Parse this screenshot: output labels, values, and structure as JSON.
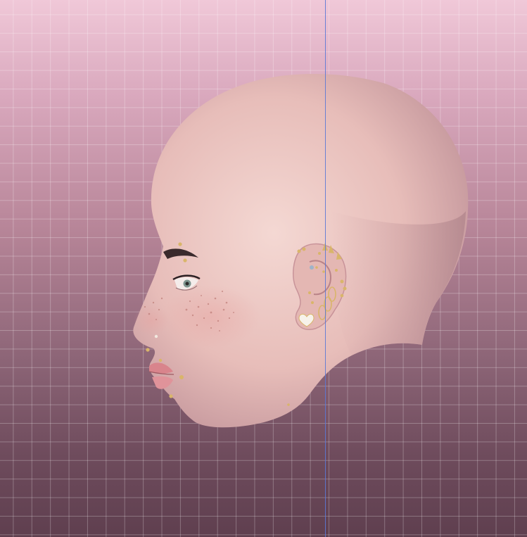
{
  "scene": {
    "subject": "head-model-profile",
    "colors": {
      "background_top": "#f0c8d8",
      "background_bottom": "#5f3f4f",
      "grid_line": "#ffffff",
      "center_axis": "#5b79d6",
      "skin_light": "#f2d4d0",
      "skin_shadow": "#b98f94",
      "jewelry_gold": "#d9b56a",
      "freckle": "#b8746e",
      "lips": "#d9848c"
    },
    "icons": [
      "head-model",
      "ear-piercings",
      "face-piercings"
    ]
  }
}
